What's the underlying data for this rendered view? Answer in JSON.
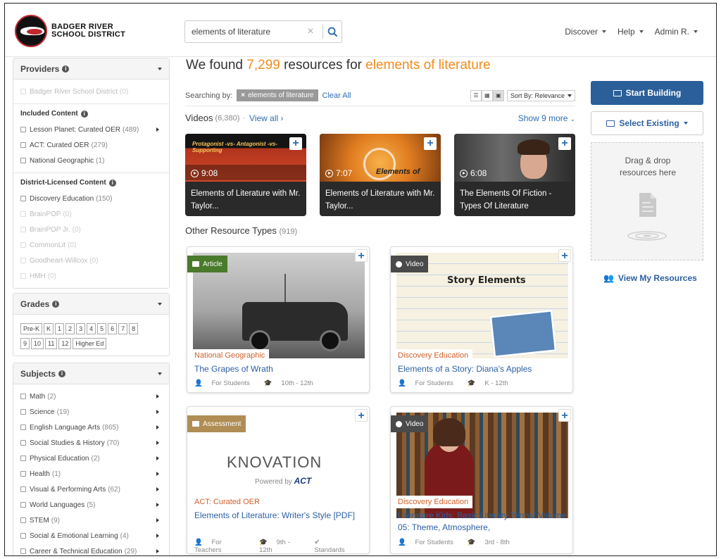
{
  "header": {
    "logo_line1": "BADGER RIVER",
    "logo_line2": "SCHOOL DISTRICT",
    "search_value": "elements of literature",
    "nav": [
      "Discover",
      "Help",
      "Admin R."
    ]
  },
  "sidebar": {
    "providers": {
      "title": "Providers",
      "items": [
        {
          "label": "Badger River School District",
          "count": "(0)"
        }
      ],
      "included_title": "Included Content",
      "included": [
        {
          "label": "Lesson Planet: Curated OER",
          "count": "(489)"
        },
        {
          "label": "ACT: Curated OER",
          "count": "(279)"
        },
        {
          "label": "National Geographic",
          "count": "(1)"
        }
      ],
      "licensed_title": "District-Licensed Content",
      "licensed": [
        {
          "label": "Discovery Education",
          "count": "(150)"
        },
        {
          "label": "BrainPOP",
          "count": "(0)"
        },
        {
          "label": "BrainPOP Jr.",
          "count": "(0)"
        },
        {
          "label": "CommonLit",
          "count": "(0)"
        },
        {
          "label": "Goodheart-Willcox",
          "count": "(0)"
        },
        {
          "label": "HMH",
          "count": "(0)"
        }
      ]
    },
    "grades": {
      "title": "Grades",
      "row1": [
        "Pre-K",
        "K",
        "1",
        "2",
        "3",
        "4",
        "5",
        "6",
        "7",
        "8"
      ],
      "row2": [
        "9",
        "10",
        "11",
        "12",
        "Higher Ed"
      ]
    },
    "subjects": {
      "title": "Subjects",
      "items": [
        {
          "label": "Math",
          "count": "(2)"
        },
        {
          "label": "Science",
          "count": "(19)"
        },
        {
          "label": "English Language Arts",
          "count": "(865)"
        },
        {
          "label": "Social Studies & History",
          "count": "(70)"
        },
        {
          "label": "Physical Education",
          "count": "(2)"
        },
        {
          "label": "Health",
          "count": "(1)"
        },
        {
          "label": "Visual & Performing Arts",
          "count": "(62)"
        },
        {
          "label": "World Languages",
          "count": "(5)"
        },
        {
          "label": "STEM",
          "count": "(9)"
        },
        {
          "label": "Social & Emotional Learning",
          "count": "(4)"
        },
        {
          "label": "Career & Technical Education",
          "count": "(29)"
        }
      ]
    }
  },
  "results": {
    "title_prefix": "We found",
    "count": "7,299",
    "title_mid": "resources for",
    "query": "elements of literature",
    "searching_by": "Searching by:",
    "tag": "elements of literature",
    "clear_all": "Clear All",
    "sort_by": "Sort By: Relevance"
  },
  "videos": {
    "label": "Videos",
    "count": "(6,380)",
    "dot": "·",
    "view_all": "View all ›",
    "show_more": "Show 9 more",
    "items": [
      {
        "duration": "9:08",
        "title": "Elements of Literature with Mr. Taylor...",
        "thumb_text": "Protagonist -vs- Antagonist -vs- Supporting"
      },
      {
        "duration": "7:07",
        "title": "Elements of Literature with Mr. Taylor...",
        "thumb_text": "Elements of"
      },
      {
        "duration": "6:08",
        "title": "The Elements Of Fiction - Types Of Literature",
        "thumb_text": ""
      }
    ]
  },
  "other": {
    "label": "Other Resource Types",
    "count": "(919)",
    "items": [
      {
        "type": "Article",
        "provider": "National Geographic",
        "title": "The Grapes of Wrath",
        "audience": "For Students",
        "grades": "10th - 12th",
        "extra": ""
      },
      {
        "type": "Video",
        "provider": "Discovery Education",
        "title": "Elements of a Story: Diana's Apples",
        "audience": "For Students",
        "grades": "K - 12th",
        "extra": "",
        "thumb_text": "Story Elements"
      },
      {
        "type": "Assessment",
        "provider": "ACT: Curated OER",
        "title": "Elements of Literature: Writer's Style [PDF]",
        "audience": "For Teachers",
        "grades": "9th - 12th",
        "extra": "Standards",
        "thumb_text": "KNOVATION",
        "thumb_sub": "Powered by",
        "thumb_brand": "ACT"
      },
      {
        "type": "Video",
        "provider": "Discovery Education",
        "title": "Literature Kids: Basic Literary Terms: Volume 05: Theme, Atmosphere,",
        "audience": "For Students",
        "grades": "3rd - 8th",
        "extra": ""
      }
    ]
  },
  "right": {
    "start_building": "Start Building",
    "select_existing": "Select Existing",
    "drop_text": "Drag & drop resources here",
    "view_my": "View My Resources"
  },
  "colors": {
    "accent": "#f08c1e",
    "primary": "#2b5f99",
    "link": "#2d6db5",
    "article": "#4a7a2c",
    "video": "#4a4a4a",
    "assessment": "#b08d55"
  }
}
